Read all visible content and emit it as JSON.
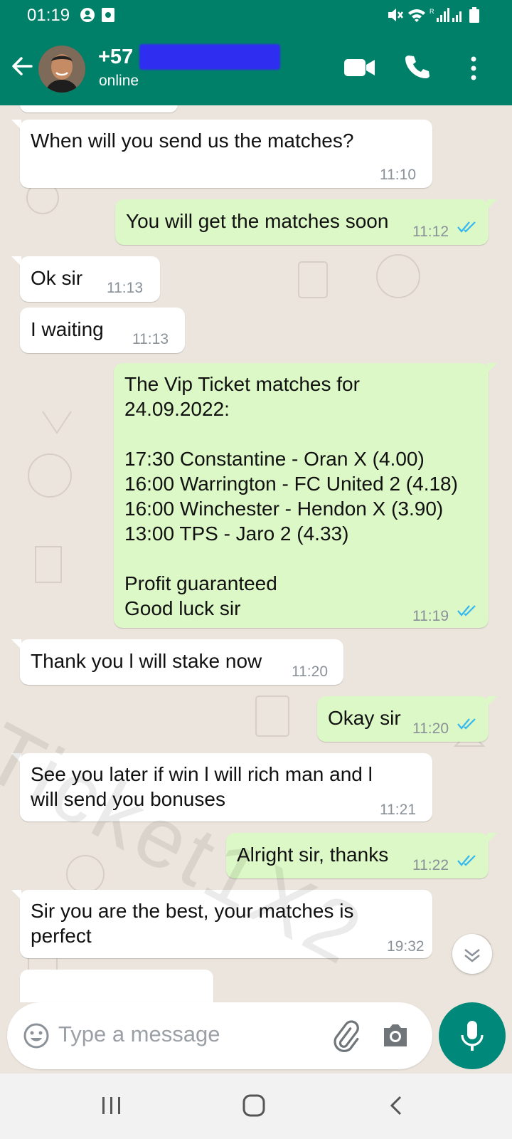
{
  "status_bar": {
    "time": "01:19"
  },
  "header": {
    "contact": "+57",
    "presence": "online"
  },
  "messages": [
    {
      "dir": "in",
      "text": "When will you send us the matches?",
      "time": "11:10"
    },
    {
      "dir": "out",
      "text": "You will get the matches soon",
      "time": "11:12"
    },
    {
      "dir": "in",
      "text": "Ok sir",
      "time": "11:13"
    },
    {
      "dir": "in",
      "text": "I waiting",
      "time": "11:13"
    },
    {
      "dir": "out",
      "text": "The Vip Ticket matches for\n24.09.2022:\n\n17:30 Constantine - Oran  X  (4.00)\n16:00 Warrington - FC United  2  (4.18)\n16:00 Winchester - Hendon  X  (3.90)\n13:00 TPS - Jaro  2  (4.33)\n\nProfit guaranteed\nGood luck sir",
      "time": "11:19"
    },
    {
      "dir": "in",
      "text": "Thank you l will stake now",
      "time": "11:20"
    },
    {
      "dir": "out",
      "text": "Okay sir",
      "time": "11:20"
    },
    {
      "dir": "in",
      "text": "See you later if win l will rich man and l\nwill send you bonuses",
      "time": "11:21"
    },
    {
      "dir": "out",
      "text": "Alright sir, thanks",
      "time": "11:22"
    },
    {
      "dir": "in",
      "text": "Sir you are the best, your matches is\nperfect",
      "time": "19:32"
    }
  ],
  "watermark": "Ticket1X2",
  "composer": {
    "placeholder": "Type a message"
  },
  "colors": {
    "header": "#008069",
    "outgoing": "#dcf8c6",
    "incoming": "#ffffff",
    "tick": "#34b7f1",
    "mic": "#00897b"
  }
}
